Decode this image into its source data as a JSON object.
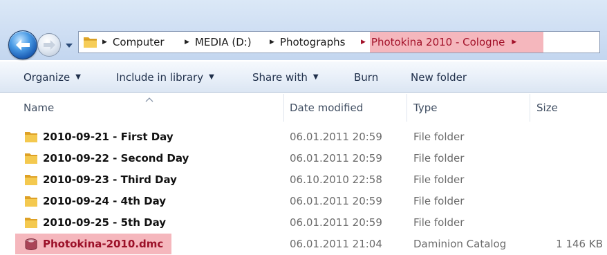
{
  "address_bar": {
    "crumbs": [
      {
        "label": "Computer",
        "current": false
      },
      {
        "label": "MEDIA (D:)",
        "current": false
      },
      {
        "label": "Photographs",
        "current": false
      },
      {
        "label": "Photokina 2010 - Cologne",
        "current": true
      }
    ],
    "icons": {
      "back": "back-arrow-icon",
      "forward": "forward-arrow-icon",
      "recent": "chevron-down-icon",
      "location": "folder-icon"
    }
  },
  "toolbar": {
    "organize": "Organize",
    "include_in_library": "Include in library",
    "share_with": "Share with",
    "burn": "Burn",
    "new_folder": "New folder"
  },
  "columns": {
    "name": "Name",
    "date_modified": "Date modified",
    "type": "Type",
    "size": "Size"
  },
  "files": [
    {
      "name": "2010-09-21 - First Day",
      "date": "06.01.2011 20:59",
      "type": "File folder",
      "size": "",
      "icon": "folder-icon"
    },
    {
      "name": "2010-09-22 - Second Day",
      "date": "06.01.2011 20:59",
      "type": "File folder",
      "size": "",
      "icon": "folder-icon"
    },
    {
      "name": "2010-09-23 - Third Day",
      "date": "06.10.2010 22:58",
      "type": "File folder",
      "size": "",
      "icon": "folder-icon"
    },
    {
      "name": "2010-09-24 - 4th Day",
      "date": "06.01.2011 20:59",
      "type": "File folder",
      "size": "",
      "icon": "folder-icon"
    },
    {
      "name": "2010-09-25 - 5th Day",
      "date": "06.01.2011 20:59",
      "type": "File folder",
      "size": "",
      "icon": "folder-icon"
    },
    {
      "name": "Photokina-2010.dmc",
      "date": "06.01.2011 21:04",
      "type": "Daminion Catalog",
      "size": "1 146 KB",
      "icon": "catalog-icon"
    }
  ],
  "colors": {
    "highlight": "#f5b7bd",
    "highlight_text": "#a3122a"
  }
}
